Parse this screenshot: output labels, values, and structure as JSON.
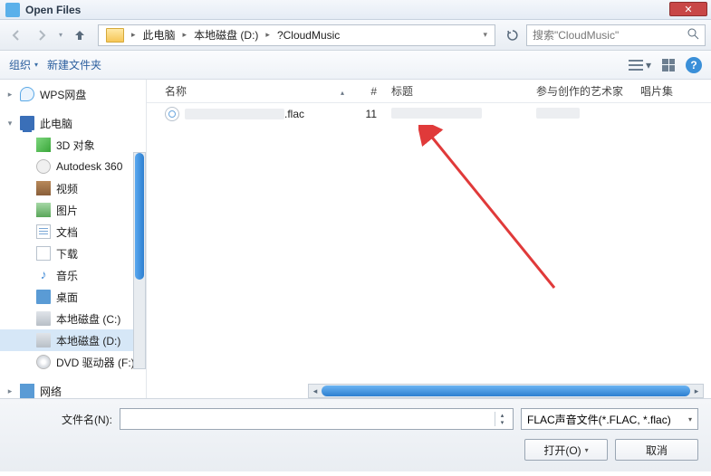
{
  "window": {
    "title": "Open Files"
  },
  "nav": {
    "crumbs": [
      "此电脑",
      "本地磁盘 (D:)",
      "?CloudMusic"
    ],
    "search_placeholder": "搜索\"CloudMusic\""
  },
  "toolbar": {
    "organize": "组织",
    "new_folder": "新建文件夹"
  },
  "sidebar": {
    "items": [
      {
        "label": "WPS网盘",
        "icon": "cloud"
      },
      {
        "label": "此电脑",
        "icon": "pc"
      },
      {
        "label": "3D 对象",
        "icon": "cube"
      },
      {
        "label": "Autodesk 360",
        "icon": "a360"
      },
      {
        "label": "视频",
        "icon": "video"
      },
      {
        "label": "图片",
        "icon": "pic"
      },
      {
        "label": "文档",
        "icon": "doc"
      },
      {
        "label": "下载",
        "icon": "dl"
      },
      {
        "label": "音乐",
        "icon": "music"
      },
      {
        "label": "桌面",
        "icon": "desk"
      },
      {
        "label": "本地磁盘 (C:)",
        "icon": "disk"
      },
      {
        "label": "本地磁盘 (D:)",
        "icon": "disk"
      },
      {
        "label": "DVD 驱动器 (F:)",
        "icon": "dvd"
      },
      {
        "label": "网络",
        "icon": "net"
      }
    ],
    "selected_index": 11
  },
  "columns": {
    "name": "名称",
    "num": "#",
    "title": "标题",
    "artist": "参与创作的艺术家",
    "album": "唱片集"
  },
  "rows": [
    {
      "ext": ".flac",
      "num": "11"
    }
  ],
  "bottom": {
    "filename_label": "文件名(N):",
    "filter": "FLAC声音文件(*.FLAC, *.flac)",
    "open": "打开(O)",
    "cancel": "取消"
  }
}
